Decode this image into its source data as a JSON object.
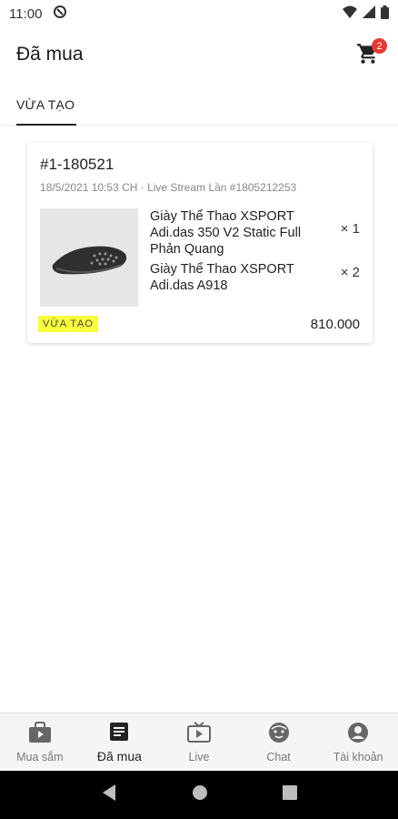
{
  "status_bar": {
    "time": "11:00"
  },
  "header": {
    "title": "Đã mua",
    "cart_count": "2"
  },
  "tabs": [
    {
      "label": "VỪA TẠO",
      "active": true
    }
  ],
  "order": {
    "id": "#1-180521",
    "meta": "18/5/2021 10:53 CH · Live Stream Lần #1805212253",
    "items": [
      {
        "name": "Giày Thể Thao XSPORT Adi.das 350 V2 Static Full Phản Quang",
        "qty": "× 1"
      },
      {
        "name": "Giày Thể Thao XSPORT Adi.das A918",
        "qty": "× 2"
      }
    ],
    "status": "VỪA TẠO",
    "total": "810.000"
  },
  "bottom_nav": [
    {
      "label": "Mua sắm",
      "icon": "shopping-video-icon"
    },
    {
      "label": "Đã mua",
      "icon": "receipt-icon",
      "active": true
    },
    {
      "label": "Live",
      "icon": "live-tv-icon"
    },
    {
      "label": "Chat",
      "icon": "chat-face-icon"
    },
    {
      "label": "Tài khoản",
      "icon": "account-icon"
    }
  ],
  "colors": {
    "status_badge_bg": "#f9ff3a",
    "cart_badge": "#e53935",
    "nav_bg": "#f5f5f5"
  }
}
